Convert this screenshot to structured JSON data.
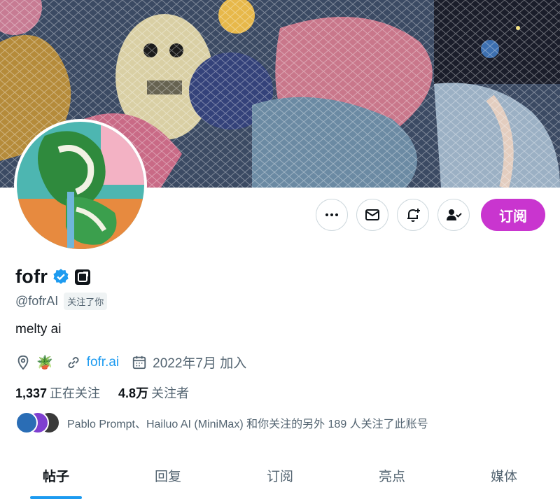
{
  "profile": {
    "display_name": "fofr",
    "handle": "@fofrAI",
    "follows_you_badge": "关注了你",
    "bio": "melty ai",
    "location_emoji": "🪴",
    "website": "fofr.ai",
    "joined": "2022年7月 加入",
    "verified_color": "#1d9bf0"
  },
  "stats": {
    "following_count": "1,337",
    "following_label": "正在关注",
    "followers_count": "4.8万",
    "followers_label": "关注者"
  },
  "followed_by": "Pablo Prompt、Hailuo AI (MiniMax) 和你关注的另外 189 人关注了此账号",
  "actions": {
    "more_icon": "more-icon",
    "message_icon": "mail-icon",
    "notify_icon": "bell-plus-icon",
    "follow_icon": "person-check-icon",
    "subscribe_label": "订阅",
    "subscribe_color": "#c935cf"
  },
  "tabs": [
    {
      "label": "帖子",
      "active": true
    },
    {
      "label": "回复",
      "active": false
    },
    {
      "label": "订阅",
      "active": false
    },
    {
      "label": "亮点",
      "active": false
    },
    {
      "label": "媒体",
      "active": false
    }
  ]
}
